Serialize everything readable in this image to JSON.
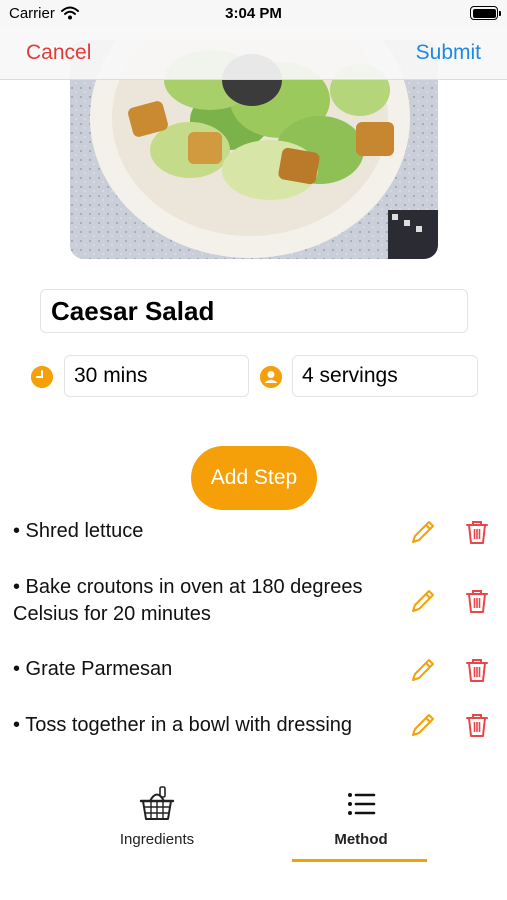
{
  "status_bar": {
    "carrier": "Carrier",
    "time": "3:04 PM"
  },
  "nav": {
    "cancel_label": "Cancel",
    "submit_label": "Submit"
  },
  "recipe": {
    "title": "Caesar Salad",
    "time": "30 mins",
    "servings": "4 servings"
  },
  "add_step_label": "Add Step",
  "steps": [
    {
      "text": "• Shred lettuce"
    },
    {
      "text": "• Bake croutons in oven at 180 degrees Celsius for 20 minutes"
    },
    {
      "text": "• Grate Parmesan"
    },
    {
      "text": "• Toss together in a bowl with dressing"
    }
  ],
  "tabs": [
    {
      "label": "Ingredients",
      "icon": "basket-icon",
      "selected": false
    },
    {
      "label": "Method",
      "icon": "list-icon",
      "selected": true
    }
  ],
  "colors": {
    "accent": "#f5a009",
    "cancel": "#e33b3b",
    "submit": "#1e88e5",
    "delete": "#e8474a"
  }
}
